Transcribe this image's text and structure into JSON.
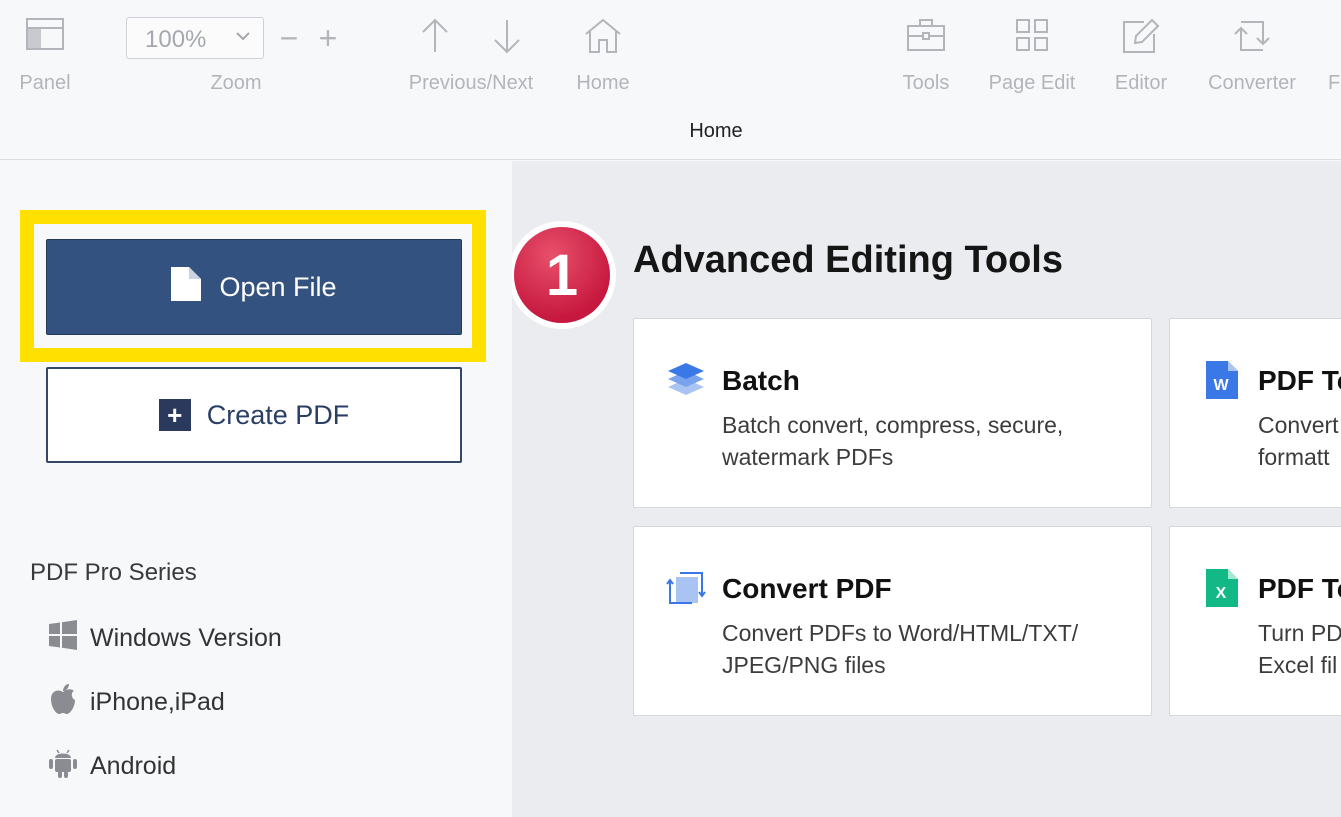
{
  "toolbar": {
    "panel_label": "Panel",
    "zoom_label": "Zoom",
    "zoom_value": "100%",
    "zoom_minus": "−",
    "zoom_plus": "+",
    "prevnext_label": "Previous/Next",
    "home_label": "Home",
    "tools_label": "Tools",
    "page_edit_label": "Page Edit",
    "editor_label": "Editor",
    "converter_label": "Converter",
    "cut_label": "F"
  },
  "window_title": "Home",
  "sidebar": {
    "open_file_label": "Open File",
    "create_pdf_label": "Create PDF",
    "create_pdf_plus": "+",
    "series_title": "PDF Pro Series",
    "series_items": [
      {
        "label": "Windows Version",
        "icon": "windows-icon"
      },
      {
        "label": "iPhone,iPad",
        "icon": "apple-icon"
      },
      {
        "label": "Android",
        "icon": "android-icon"
      }
    ]
  },
  "main": {
    "step_badge": "1",
    "section_title": "Advanced Editing Tools",
    "cards": [
      {
        "title": "Batch",
        "desc": "Batch convert, compress, secure,\nwatermark PDFs",
        "icon": "layers-icon"
      },
      {
        "title": "PDF To",
        "desc": "Convert\nformatt",
        "icon": "word-icon",
        "icon_text": "W"
      },
      {
        "title": "Convert PDF",
        "desc": "Convert PDFs to Word/HTML/TXT/\nJPEG/PNG files",
        "icon": "convert-icon"
      },
      {
        "title": "PDF To",
        "desc": "Turn PD\nExcel fil",
        "icon": "excel-icon",
        "icon_text": "X"
      }
    ]
  },
  "colors": {
    "accent": "#34527f",
    "highlight": "#ffe000",
    "badge": "#d12247",
    "word": "#3b78e7",
    "excel": "#12b886"
  }
}
